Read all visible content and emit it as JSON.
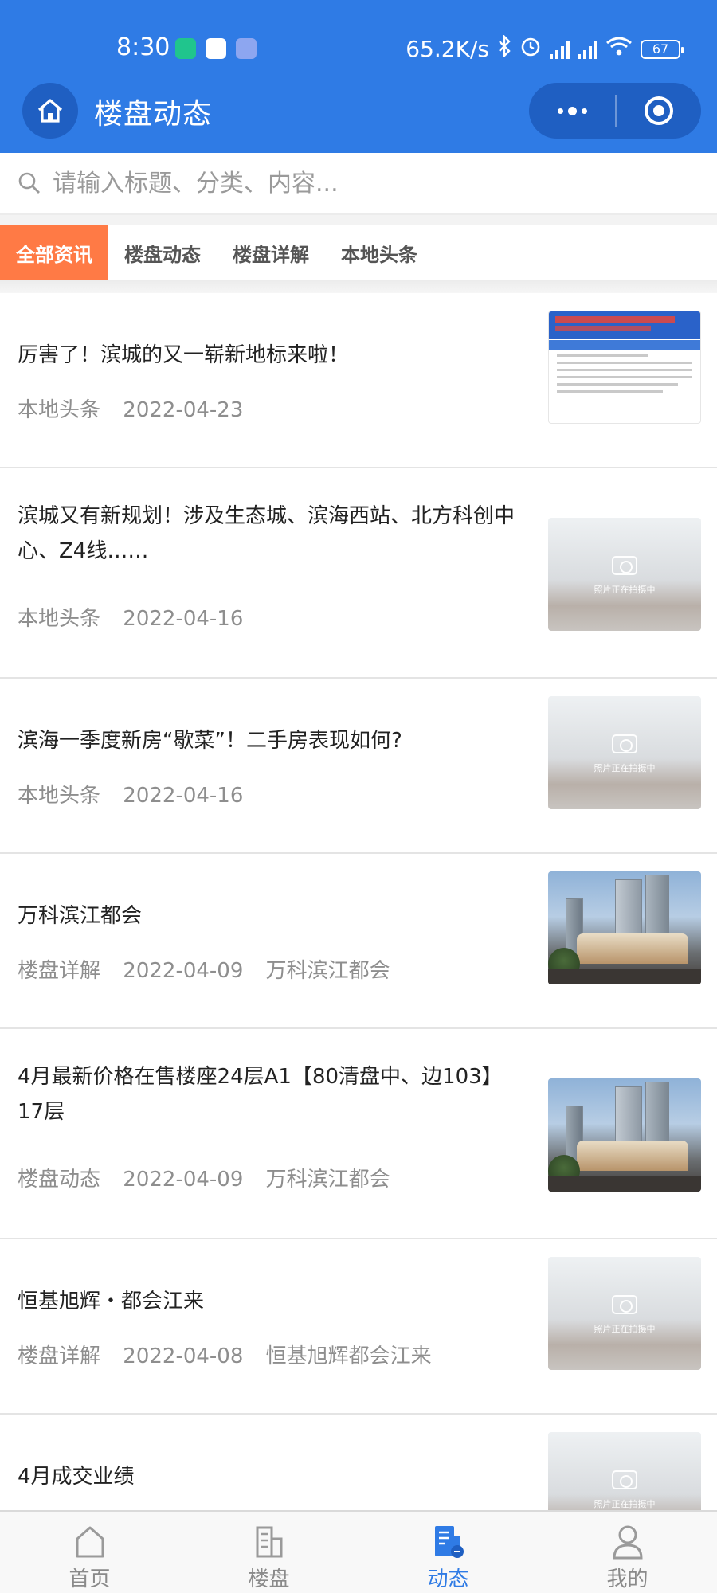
{
  "status_bar": {
    "time": "8:30",
    "network_speed": "65.2K/s",
    "battery": "67",
    "icons": [
      "shield-app-icon",
      "baidu-icon",
      "app-icon",
      "bluetooth-icon",
      "alarm-icon",
      "hd-signal-icon",
      "hd-signal-icon",
      "wifi-icon",
      "battery-icon"
    ]
  },
  "nav": {
    "title": "楼盘动态",
    "home_icon": "home-icon",
    "more_icon": "more-icon",
    "close_icon": "target-icon"
  },
  "search": {
    "placeholder": "请输入标题、分类、内容..."
  },
  "tabs": [
    {
      "label": "全部资讯",
      "active": true
    },
    {
      "label": "楼盘动态",
      "active": false
    },
    {
      "label": "楼盘详解",
      "active": false
    },
    {
      "label": "本地头条",
      "active": false
    }
  ],
  "articles": [
    {
      "title": "厉害了！滨城的又一崭新地标来啦！",
      "category": "本地头条",
      "date": "2022-04-23",
      "project": "",
      "thumb": "document"
    },
    {
      "title": "滨城又有新规划！涉及生态城、滨海西站、北方科创中心、Z4线……",
      "category": "本地头条",
      "date": "2022-04-16",
      "project": "",
      "thumb": "placeholder"
    },
    {
      "title": "滨海一季度新房“歇菜”！二手房表现如何?",
      "category": "本地头条",
      "date": "2022-04-16",
      "project": "",
      "thumb": "placeholder"
    },
    {
      "title": "万科滨江都会",
      "category": "楼盘详解",
      "date": "2022-04-09",
      "project": "万科滨江都会",
      "thumb": "building"
    },
    {
      "title": "4月最新价格在售楼座24层A1【80清盘中、边103】17层",
      "category": "楼盘动态",
      "date": "2022-04-09",
      "project": "万科滨江都会",
      "thumb": "building"
    },
    {
      "title": "恒基旭辉・都会江来",
      "category": "楼盘详解",
      "date": "2022-04-08",
      "project": "恒基旭辉都会江来",
      "thumb": "placeholder"
    },
    {
      "title": "4月成交业绩",
      "category": "",
      "date": "",
      "project": "",
      "thumb": "placeholder"
    }
  ],
  "placeholder_text": "照片正在拍摄中",
  "bottom_nav": [
    {
      "label": "首页",
      "icon": "home-icon",
      "active": false
    },
    {
      "label": "楼盘",
      "icon": "building-icon",
      "active": false
    },
    {
      "label": "动态",
      "icon": "news-icon",
      "active": true
    },
    {
      "label": "我的",
      "icon": "user-icon",
      "active": false
    }
  ],
  "colors": {
    "header": "#2f7be5",
    "active_tab": "#ff7a45",
    "active_nav": "#2f7be5"
  }
}
